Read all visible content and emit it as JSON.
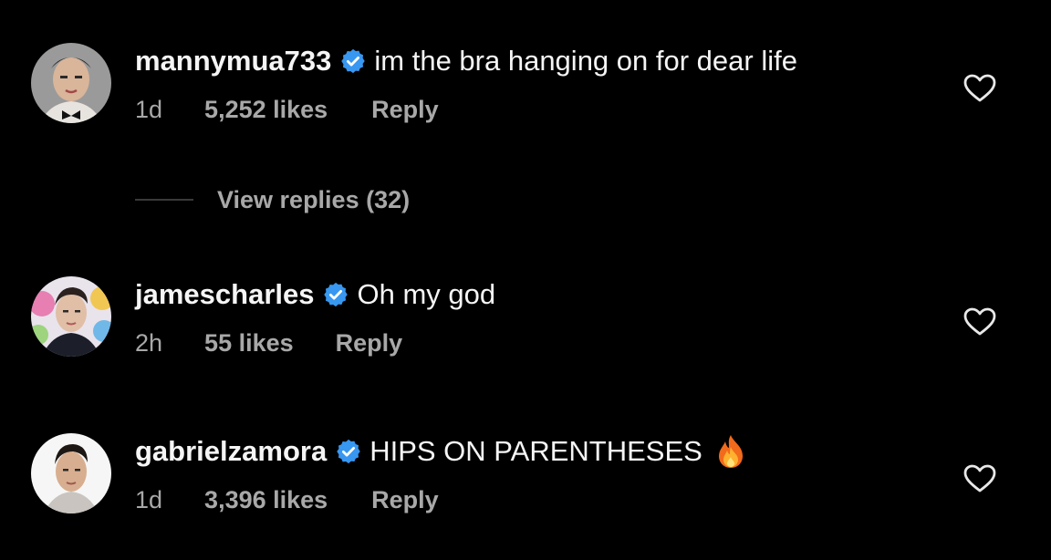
{
  "comments": [
    {
      "username": "mannymua733",
      "verified": true,
      "text": "im the bra hanging on for dear life",
      "time": "1d",
      "likes": "5,252 likes",
      "reply_label": "Reply",
      "avatar": "profile-photo",
      "liked": false
    },
    {
      "username": "jamescharles",
      "verified": true,
      "text": "Oh my god",
      "time": "2h",
      "likes": "55 likes",
      "reply_label": "Reply",
      "avatar": "profile-photo",
      "liked": false
    },
    {
      "username": "gabrielzamora",
      "verified": true,
      "text": "HIPS ON PARENTHESES",
      "emoji": "fire",
      "time": "1d",
      "likes": "3,396 likes",
      "reply_label": "Reply",
      "avatar": "profile-photo",
      "liked": false
    }
  ],
  "view_replies": {
    "label": "View replies (32)"
  },
  "colors": {
    "background": "#000000",
    "text_primary": "#f5f5f5",
    "text_secondary": "#a8a8a8",
    "verified_badge": "#3897f0",
    "divider": "#3a3a3a"
  },
  "icons": {
    "verified": "verified-badge-icon",
    "like": "heart-outline-icon",
    "emoji": "fire-emoji-icon"
  }
}
